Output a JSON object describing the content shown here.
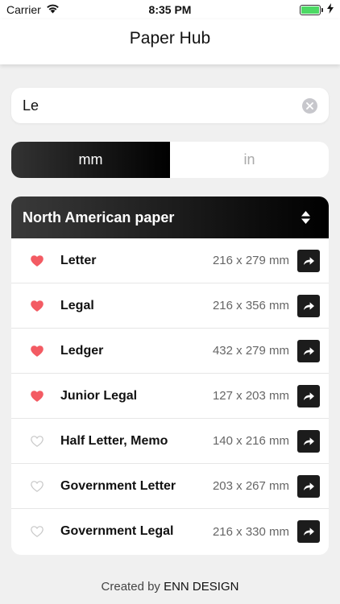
{
  "status_bar": {
    "carrier": "Carrier",
    "time": "8:35 PM",
    "battery_level": 1.0,
    "battery_color": "#4cd964"
  },
  "nav": {
    "title": "Paper Hub"
  },
  "search": {
    "value": "Le",
    "placeholder": ""
  },
  "unit_toggle": {
    "options": [
      "mm",
      "in"
    ],
    "selected": "mm"
  },
  "section": {
    "title": "North American paper",
    "items": [
      {
        "name": "Letter",
        "size": "216 x 279 mm",
        "favorite": true
      },
      {
        "name": "Legal",
        "size": "216 x 356 mm",
        "favorite": true
      },
      {
        "name": "Ledger",
        "size": "432 x 279 mm",
        "favorite": true
      },
      {
        "name": "Junior Legal",
        "size": "127 x 203 mm",
        "favorite": true
      },
      {
        "name": "Half Letter, Memo",
        "size": "140 x 216 mm",
        "favorite": false
      },
      {
        "name": "Government Letter",
        "size": "203 x 267 mm",
        "favorite": false
      },
      {
        "name": "Government Legal",
        "size": "216 x 330 mm",
        "favorite": false
      }
    ]
  },
  "footer": {
    "prefix": "Created by",
    "brand": "ENN DESIGN"
  },
  "colors": {
    "favorite": "#f35b63",
    "favorite_off": "#c8c8c8",
    "accent_dark": "#000000"
  }
}
